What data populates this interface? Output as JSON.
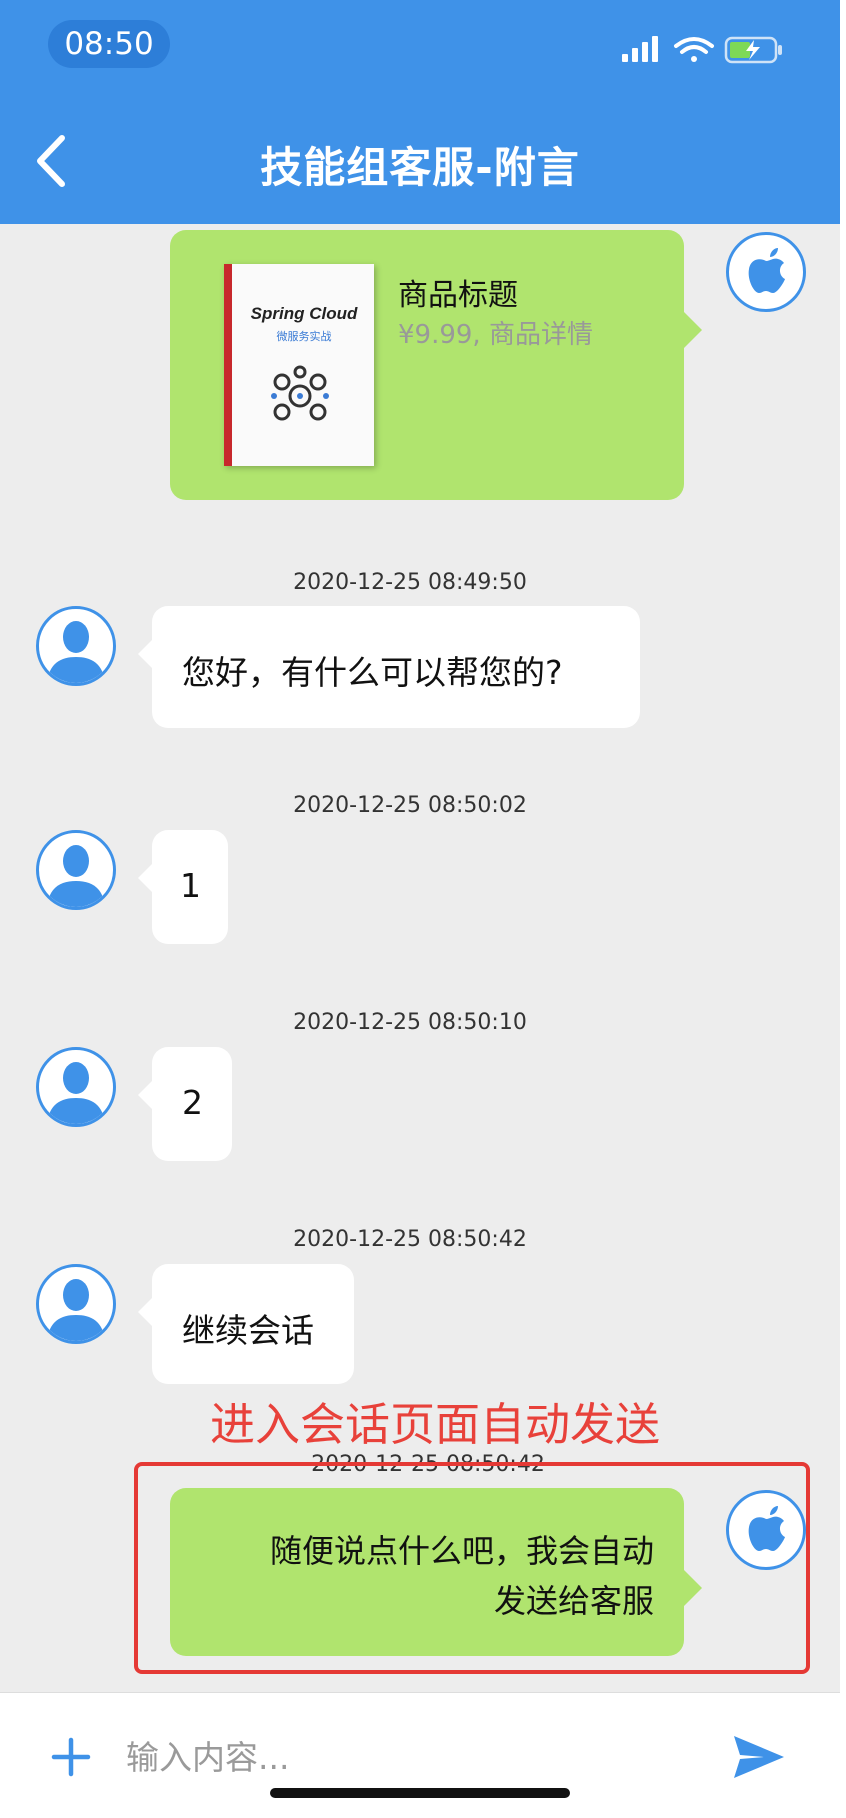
{
  "status_bar": {
    "time": "08:50"
  },
  "header": {
    "title": "技能组客服-附言"
  },
  "product": {
    "title": "商品标题",
    "subtitle": "¥9.99, 商品详情",
    "book_title": "Spring Cloud",
    "book_subtitle": "微服务实战"
  },
  "messages": [
    {
      "timestamp": "2020-12-25 08:49:50",
      "text": "您好，有什么可以帮您的?"
    },
    {
      "timestamp": "2020-12-25 08:50:02",
      "text": "1"
    },
    {
      "timestamp": "2020-12-25 08:50:10",
      "text": "2"
    },
    {
      "timestamp": "2020-12-25 08:50:42",
      "text": "继续会话"
    }
  ],
  "auto_message": {
    "timestamp": "2020-12-25 08:50:42",
    "line1": "随便说点什么吧，我会自动",
    "line2": "发送给客服"
  },
  "annotation": "进入会话页面自动发送",
  "input": {
    "placeholder": "输入内容..."
  },
  "colors": {
    "header": "#3f92e8",
    "green_bubble": "#b0e46e",
    "annotation": "#e8413a"
  }
}
